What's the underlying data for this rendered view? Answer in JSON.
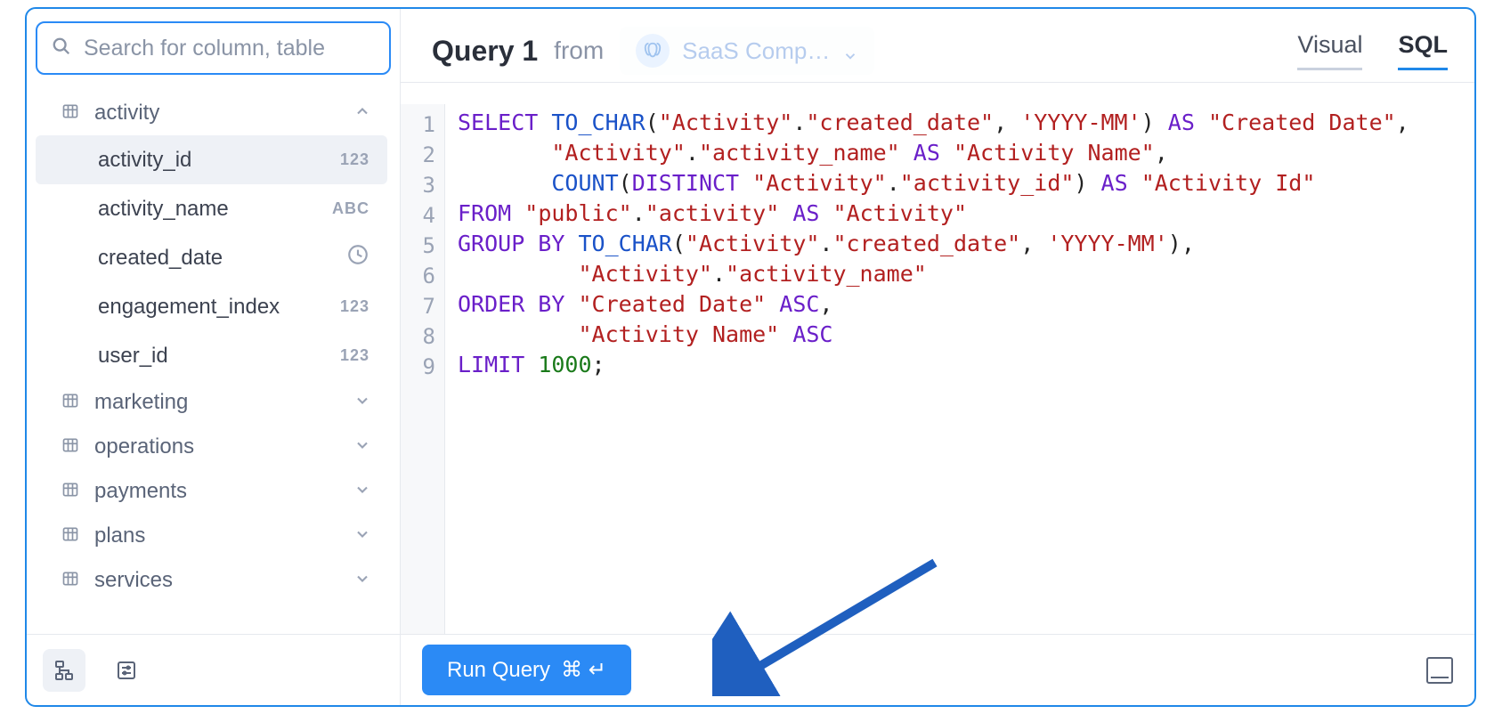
{
  "sidebar": {
    "search_placeholder": "Search for column, table",
    "tables": [
      {
        "name": "activity",
        "expanded": true
      },
      {
        "name": "marketing",
        "expanded": false
      },
      {
        "name": "operations",
        "expanded": false
      },
      {
        "name": "payments",
        "expanded": false
      },
      {
        "name": "plans",
        "expanded": false
      },
      {
        "name": "services",
        "expanded": false
      }
    ],
    "activity_columns": [
      {
        "name": "activity_id",
        "type": "123",
        "selected": true
      },
      {
        "name": "activity_name",
        "type": "ABC"
      },
      {
        "name": "created_date",
        "type": "clock"
      },
      {
        "name": "engagement_index",
        "type": "123"
      },
      {
        "name": "user_id",
        "type": "123"
      }
    ]
  },
  "header": {
    "title": "Query 1",
    "from_label": "from",
    "datasource": "SaaS Comp…",
    "tabs": {
      "visual": "Visual",
      "sql": "SQL",
      "active": "sql"
    }
  },
  "sql": {
    "line_numbers": [
      "1",
      "2",
      "3",
      "4",
      "5",
      "6",
      "7",
      "8",
      "9"
    ],
    "tokens": [
      [
        {
          "c": "kw",
          "t": "SELECT"
        },
        {
          "c": "pn",
          "t": " "
        },
        {
          "c": "fn",
          "t": "TO_CHAR"
        },
        {
          "c": "pn",
          "t": "("
        },
        {
          "c": "str",
          "t": "\"Activity\""
        },
        {
          "c": "pn",
          "t": "."
        },
        {
          "c": "str",
          "t": "\"created_date\""
        },
        {
          "c": "pn",
          "t": ", "
        },
        {
          "c": "str",
          "t": "'YYYY-MM'"
        },
        {
          "c": "pn",
          "t": ") "
        },
        {
          "c": "kw",
          "t": "AS"
        },
        {
          "c": "pn",
          "t": " "
        },
        {
          "c": "str",
          "t": "\"Created Date\""
        },
        {
          "c": "pn",
          "t": ","
        }
      ],
      [
        {
          "c": "pn",
          "t": "       "
        },
        {
          "c": "str",
          "t": "\"Activity\""
        },
        {
          "c": "pn",
          "t": "."
        },
        {
          "c": "str",
          "t": "\"activity_name\""
        },
        {
          "c": "pn",
          "t": " "
        },
        {
          "c": "kw",
          "t": "AS"
        },
        {
          "c": "pn",
          "t": " "
        },
        {
          "c": "str",
          "t": "\"Activity Name\""
        },
        {
          "c": "pn",
          "t": ","
        }
      ],
      [
        {
          "c": "pn",
          "t": "       "
        },
        {
          "c": "fn",
          "t": "COUNT"
        },
        {
          "c": "pn",
          "t": "("
        },
        {
          "c": "kw",
          "t": "DISTINCT"
        },
        {
          "c": "pn",
          "t": " "
        },
        {
          "c": "str",
          "t": "\"Activity\""
        },
        {
          "c": "pn",
          "t": "."
        },
        {
          "c": "str",
          "t": "\"activity_id\""
        },
        {
          "c": "pn",
          "t": ") "
        },
        {
          "c": "kw",
          "t": "AS"
        },
        {
          "c": "pn",
          "t": " "
        },
        {
          "c": "str",
          "t": "\"Activity Id\""
        }
      ],
      [
        {
          "c": "kw",
          "t": "FROM"
        },
        {
          "c": "pn",
          "t": " "
        },
        {
          "c": "str",
          "t": "\"public\""
        },
        {
          "c": "pn",
          "t": "."
        },
        {
          "c": "str",
          "t": "\"activity\""
        },
        {
          "c": "pn",
          "t": " "
        },
        {
          "c": "kw",
          "t": "AS"
        },
        {
          "c": "pn",
          "t": " "
        },
        {
          "c": "str",
          "t": "\"Activity\""
        }
      ],
      [
        {
          "c": "kw",
          "t": "GROUP BY"
        },
        {
          "c": "pn",
          "t": " "
        },
        {
          "c": "fn",
          "t": "TO_CHAR"
        },
        {
          "c": "pn",
          "t": "("
        },
        {
          "c": "str",
          "t": "\"Activity\""
        },
        {
          "c": "pn",
          "t": "."
        },
        {
          "c": "str",
          "t": "\"created_date\""
        },
        {
          "c": "pn",
          "t": ", "
        },
        {
          "c": "str",
          "t": "'YYYY-MM'"
        },
        {
          "c": "pn",
          "t": "),"
        }
      ],
      [
        {
          "c": "pn",
          "t": "         "
        },
        {
          "c": "str",
          "t": "\"Activity\""
        },
        {
          "c": "pn",
          "t": "."
        },
        {
          "c": "str",
          "t": "\"activity_name\""
        }
      ],
      [
        {
          "c": "kw",
          "t": "ORDER BY"
        },
        {
          "c": "pn",
          "t": " "
        },
        {
          "c": "str",
          "t": "\"Created Date\""
        },
        {
          "c": "pn",
          "t": " "
        },
        {
          "c": "kw",
          "t": "ASC"
        },
        {
          "c": "pn",
          "t": ","
        }
      ],
      [
        {
          "c": "pn",
          "t": "         "
        },
        {
          "c": "str",
          "t": "\"Activity Name\""
        },
        {
          "c": "pn",
          "t": " "
        },
        {
          "c": "kw",
          "t": "ASC"
        }
      ],
      [
        {
          "c": "kw",
          "t": "LIMIT"
        },
        {
          "c": "pn",
          "t": " "
        },
        {
          "c": "num",
          "t": "1000"
        },
        {
          "c": "pn",
          "t": ";"
        }
      ]
    ]
  },
  "footer": {
    "run_label": "Run Query",
    "shortcut": "⌘ ↵"
  }
}
